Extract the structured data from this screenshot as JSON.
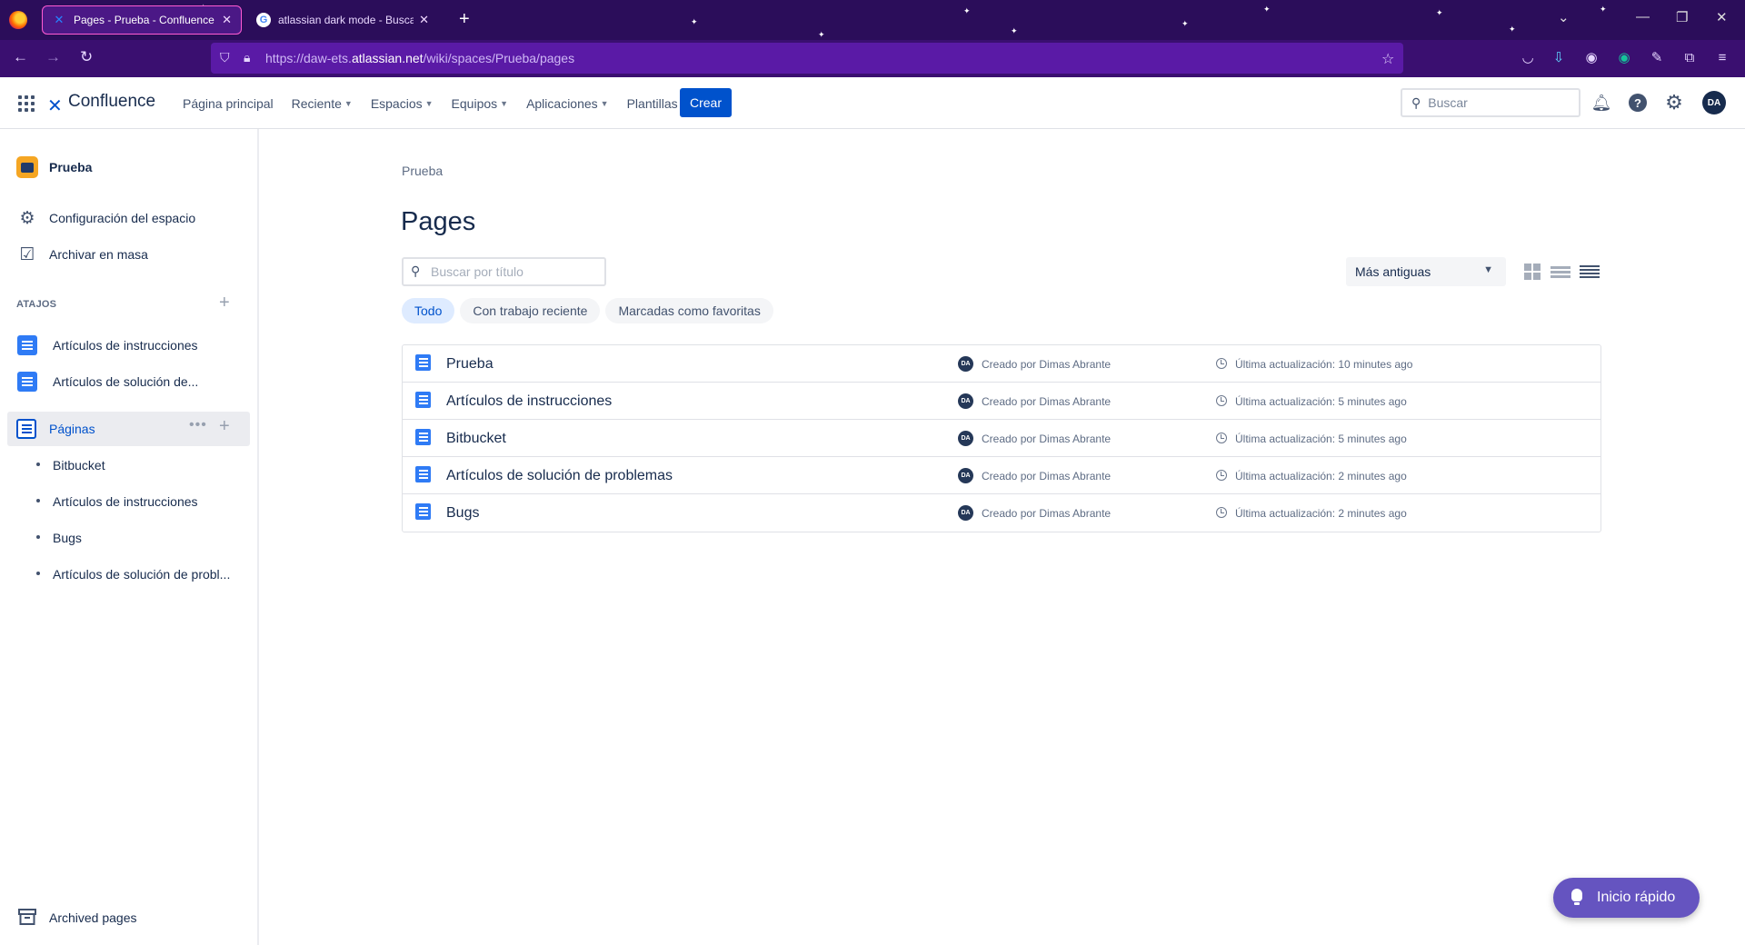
{
  "browser": {
    "tabs": [
      {
        "title": "Pages - Prueba - Confluence",
        "active": true
      },
      {
        "title": "atlassian dark mode - Buscar c",
        "active": false
      }
    ],
    "url_prefix": "https://daw-ets.",
    "url_host": "atlassian.net",
    "url_path": "/wiki/spaces/Prueba/pages",
    "accent_color": "#3a0f70"
  },
  "header": {
    "app_name": "Confluence",
    "nav": [
      {
        "label": "Página principal",
        "dropdown": false
      },
      {
        "label": "Reciente",
        "dropdown": true
      },
      {
        "label": "Espacios",
        "dropdown": true
      },
      {
        "label": "Equipos",
        "dropdown": true
      },
      {
        "label": "Aplicaciones",
        "dropdown": true
      },
      {
        "label": "Plantillas",
        "dropdown": false
      }
    ],
    "create_label": "Crear",
    "search_placeholder": "Buscar",
    "avatar_initials": "DA",
    "brand_color": "#0052cc"
  },
  "sidebar": {
    "space_name": "Prueba",
    "settings_label": "Configuración del espacio",
    "bulk_archive_label": "Archivar en masa",
    "shortcuts_title": "ATAJOS",
    "shortcuts": [
      {
        "label": "Artículos de instrucciones"
      },
      {
        "label": "Artículos de solución de..."
      }
    ],
    "pages_label": "Páginas",
    "more_label": "•••",
    "children": [
      {
        "label": "Bitbucket"
      },
      {
        "label": "Artículos de instrucciones"
      },
      {
        "label": "Bugs"
      },
      {
        "label": "Artículos de solución de probl..."
      }
    ],
    "archived_label": "Archived pages"
  },
  "main": {
    "breadcrumb": "Prueba",
    "title": "Pages",
    "search_placeholder": "Buscar por título",
    "sort_label": "Más antiguas",
    "filters": [
      {
        "label": "Todo",
        "active": true
      },
      {
        "label": "Con trabajo reciente",
        "active": false
      },
      {
        "label": "Marcadas como favoritas",
        "active": false
      }
    ],
    "pages": [
      {
        "title": "Prueba",
        "creator_initials": "DA",
        "creator": "Creado por Dimas Abrante",
        "updated": "Última actualización: 10 minutes ago"
      },
      {
        "title": "Artículos de instrucciones",
        "creator_initials": "DA",
        "creator": "Creado por Dimas Abrante",
        "updated": "Última actualización: 5 minutes ago"
      },
      {
        "title": "Bitbucket",
        "creator_initials": "DA",
        "creator": "Creado por Dimas Abrante",
        "updated": "Última actualización: 5 minutes ago"
      },
      {
        "title": "Artículos de solución de problemas",
        "creator_initials": "DA",
        "creator": "Creado por Dimas Abrante",
        "updated": "Última actualización: 2 minutes ago"
      },
      {
        "title": "Bugs",
        "creator_initials": "DA",
        "creator": "Creado por Dimas Abrante",
        "updated": "Última actualización: 2 minutes ago"
      }
    ]
  },
  "quickstart_label": "Inicio rápido",
  "quickstart_color": "#6554c0"
}
